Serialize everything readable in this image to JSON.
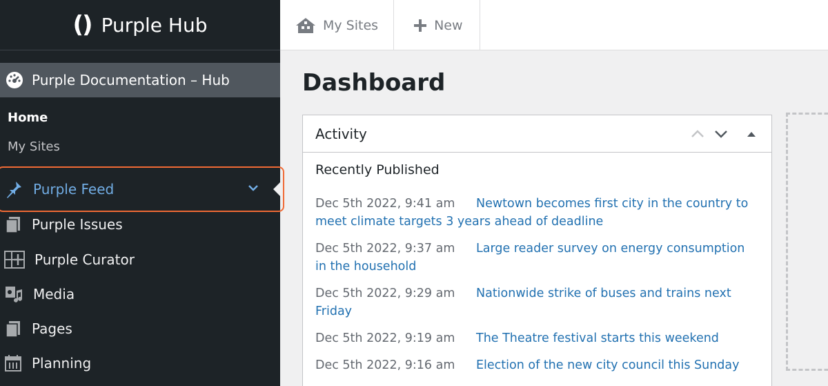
{
  "brand": {
    "logo": "()",
    "name": "Purple Hub"
  },
  "sidebar": {
    "site": "Purple Documentation – Hub",
    "sub_home": "Home",
    "sub_mysites": "My Sites",
    "items": [
      {
        "label": "Purple Feed",
        "icon": "pin-icon"
      },
      {
        "label": "Purple Issues",
        "icon": "pages-icon"
      },
      {
        "label": "Purple Curator",
        "icon": "grid-plus-icon"
      },
      {
        "label": "Media",
        "icon": "media-icon"
      },
      {
        "label": "Pages",
        "icon": "pages-icon"
      },
      {
        "label": "Planning",
        "icon": "calendar-icon"
      }
    ]
  },
  "topbar": {
    "mysites": "My Sites",
    "new": "New"
  },
  "main": {
    "title": "Dashboard",
    "panel_title": "Activity",
    "recent_title": "Recently Published",
    "entries": [
      {
        "date": "Dec 5th 2022, 9:41 am",
        "title": "Newtown becomes first city in the country to meet climate targets 3 years ahead of deadline"
      },
      {
        "date": "Dec 5th 2022, 9:37 am",
        "title": "Large reader survey on energy consumption in the household"
      },
      {
        "date": "Dec 5th 2022, 9:29 am",
        "title": "Nationwide strike of buses and trains next Friday"
      },
      {
        "date": "Dec 5th 2022, 9:19 am",
        "title": "The Theatre festival starts this weekend"
      },
      {
        "date": "Dec 5th 2022, 9:16 am",
        "title": "Election of the new city council this Sunday"
      }
    ]
  },
  "colors": {
    "sidebar_bg": "#1d2327",
    "active": "#72aee6",
    "link": "#2271b1",
    "highlight": "#f06a35"
  }
}
